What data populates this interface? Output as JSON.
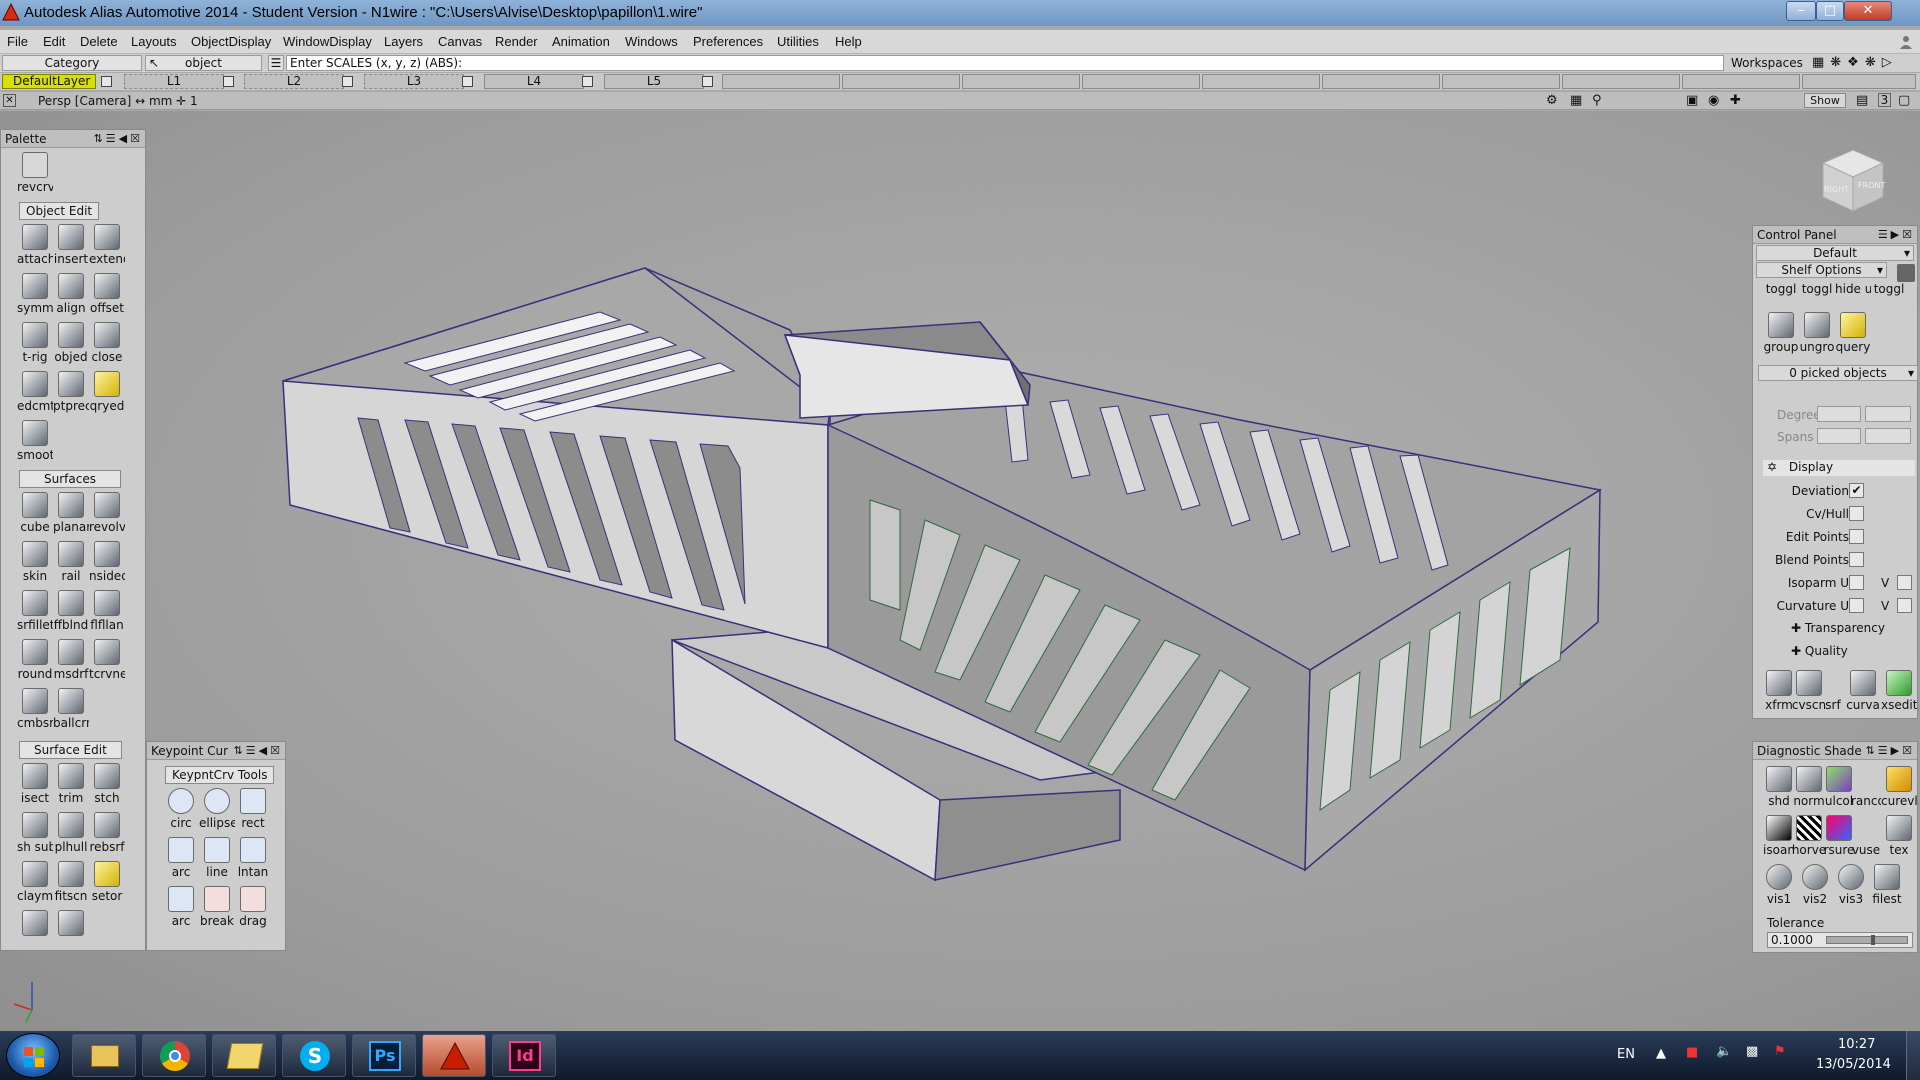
{
  "window": {
    "title": "Autodesk Alias Automotive 2014   - Student Version   - N1wire : \"C:\\Users\\Alvise\\Desktop\\papillon\\1.wire\""
  },
  "menu": [
    "File",
    "Edit",
    "Delete",
    "Layouts",
    "ObjectDisplay",
    "WindowDisplay",
    "Layers",
    "Canvas",
    "Render",
    "Animation",
    "Windows",
    "Preferences",
    "Utilities",
    "Help"
  ],
  "toolbar": {
    "category_label": "Category",
    "object_label": "object",
    "prompt": "Enter SCALES (x, y, z) (ABS):",
    "workspaces_label": "Workspaces"
  },
  "layers": {
    "default": "DefaultLayer",
    "l1": "L1",
    "l2": "L2",
    "l3": "L3",
    "l4": "L4",
    "l5": "L5"
  },
  "viewport": {
    "label": "Persp [Camera] ↔ mm   ✛ 1",
    "show_label": "Show",
    "viewcube_labels": [
      "RIGHT",
      "FRONT"
    ]
  },
  "palette": {
    "title": "Palette",
    "top_tool": "revcrv",
    "sections": [
      {
        "name": "Object Edit",
        "tools": [
          "attach",
          "insert",
          "extend",
          "symm",
          "align",
          "offset",
          "t-rig",
          "objed",
          "close",
          "edcmt",
          "ptprec",
          "qryed",
          "smooth"
        ]
      },
      {
        "name": "Surfaces",
        "tools": [
          "cube",
          "planar",
          "revolv",
          "skin",
          "rail",
          "nsided",
          "srfillet",
          "ffblnd",
          "flfllan",
          "round",
          "msdrf",
          "tcrvnet",
          "cmbsrf",
          "ballcrn"
        ]
      },
      {
        "name": "Surface Edit",
        "tools": [
          "isect",
          "trim",
          "stch",
          "sh sub",
          "plhull",
          "rebsrf",
          "claymt",
          "fitscn",
          "setor",
          "",
          ""
        ]
      }
    ]
  },
  "keypoint": {
    "title": "Keypoint Cur",
    "tab": "KeypntCrv Tools",
    "tools": [
      "circ",
      "ellipse",
      "rect",
      "arc",
      "line",
      "lntan",
      "arc",
      "break",
      "drag"
    ]
  },
  "control_panel": {
    "title": "Control Panel",
    "preset": "Default",
    "shelf": "Shelf Options",
    "shelf_tools": [
      "toggl",
      "toggl",
      "hide u",
      "toggl",
      "group",
      "ungro",
      "query"
    ],
    "picked": "0 picked objects",
    "degree_label": "Degree",
    "spans_label": "Spans",
    "display_label": "Display",
    "rows": [
      {
        "label": "Deviation",
        "checked": "✔"
      },
      {
        "label": "Cv/Hull",
        "checked": ""
      },
      {
        "label": "Edit Points",
        "checked": ""
      },
      {
        "label": "Blend Points",
        "checked": ""
      },
      {
        "label": "Isoparm U",
        "checked": ""
      },
      {
        "label": "Curvature U",
        "checked": ""
      }
    ],
    "v_label": "V",
    "transparency_label": "Transparency",
    "quality_label": "Quality",
    "bottom_tools": [
      "xfrm",
      "cvscn",
      "srf",
      "curva",
      "xsedit"
    ]
  },
  "diagnostic": {
    "title": "Diagnostic Shade",
    "tools": [
      "shd",
      "norm",
      "ulcol",
      "ranco",
      "curevl",
      "isoan",
      "horve",
      "rsure",
      "vuse",
      "tex",
      "vis1",
      "vis2",
      "vis3",
      "filest"
    ],
    "tolerance_label": "Tolerance",
    "tolerance_value": "0.1000"
  },
  "taskbar": {
    "lang": "EN",
    "time": "10:27",
    "date": "13/05/2014",
    "apps": [
      "explorer",
      "chrome",
      "folder",
      "skype",
      "photoshop",
      "alias",
      "indesign"
    ],
    "ps_label": "Ps",
    "id_label": "Id",
    "skype_label": "S"
  }
}
